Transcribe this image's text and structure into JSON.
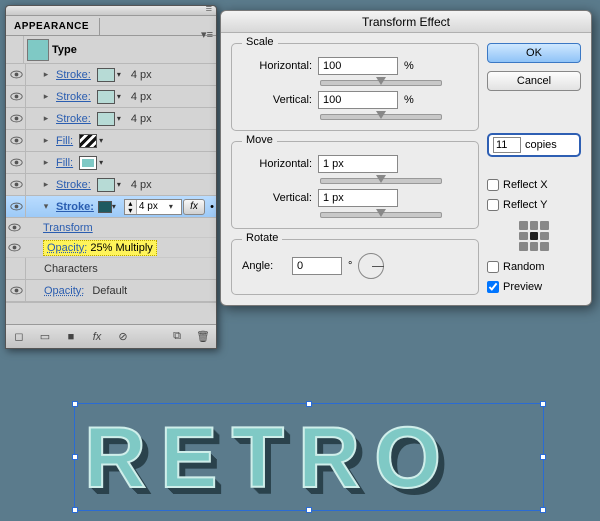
{
  "appearance": {
    "panel_title": "APPEARANCE",
    "type_label": "Type",
    "rows": [
      {
        "kind": "stroke",
        "label": "Stroke:",
        "swatch": "#b7dbd6",
        "value": "4 px"
      },
      {
        "kind": "stroke",
        "label": "Stroke:",
        "swatch": "#b7dbd6",
        "value": "4 px"
      },
      {
        "kind": "stroke",
        "label": "Stroke:",
        "swatch": "#b7dbd6",
        "value": "4 px"
      },
      {
        "kind": "fill",
        "label": "Fill:",
        "swatch": "chevron",
        "value": ""
      },
      {
        "kind": "fill",
        "label": "Fill:",
        "swatch": "#7fc9c5",
        "value": ""
      },
      {
        "kind": "stroke",
        "label": "Stroke:",
        "swatch": "#b7dbd6",
        "value": "4 px"
      }
    ],
    "selected": {
      "label": "Stroke:",
      "value": "4 px",
      "sub_transform": "Transform",
      "sub_opacity_label": "Opacity:",
      "sub_opacity_value": "25% Multiply"
    },
    "characters_label": "Characters",
    "default_opacity_label": "Opacity:",
    "default_opacity_value": "Default",
    "footer_fx": "fx"
  },
  "dialog": {
    "title": "Transform Effect",
    "scale_title": "Scale",
    "move_title": "Move",
    "rotate_title": "Rotate",
    "scale_h_label": "Horizontal:",
    "scale_h_value": "100",
    "scale_v_label": "Vertical:",
    "scale_v_value": "100",
    "percent": "%",
    "move_h_label": "Horizontal:",
    "move_h_value": "1 px",
    "move_v_label": "Vertical:",
    "move_v_value": "1 px",
    "angle_label": "Angle:",
    "angle_value": "0",
    "degree": "°",
    "ok": "OK",
    "cancel": "Cancel",
    "copies_value": "11",
    "copies_label": "copies",
    "reflect_x": "Reflect X",
    "reflect_y": "Reflect Y",
    "random": "Random",
    "preview": "Preview",
    "preview_checked": true
  },
  "art": {
    "text": "RETRO"
  }
}
